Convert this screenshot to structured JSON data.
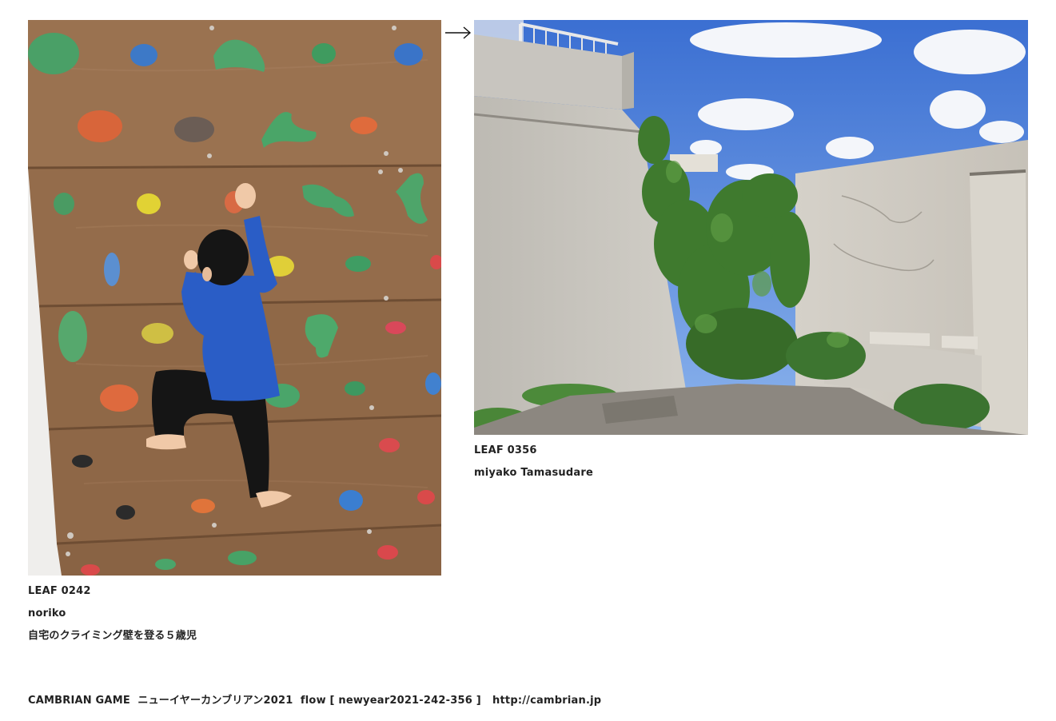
{
  "leaves": [
    {
      "id_label": "LEAF 0242",
      "author": "noriko",
      "title": "自宅のクライミング壁を登る５歳児"
    },
    {
      "id_label": "LEAF 0356",
      "author": "miyako Tamasudare"
    }
  ],
  "footer": {
    "game": "CAMBRIAN GAME",
    "event": "ニューイヤーカンブリアン2021",
    "flow": "flow [ newyear2021-242-356 ]",
    "url": "http://cambrian.jp"
  },
  "icons": {
    "link_arrow": "right-arrow-icon"
  }
}
